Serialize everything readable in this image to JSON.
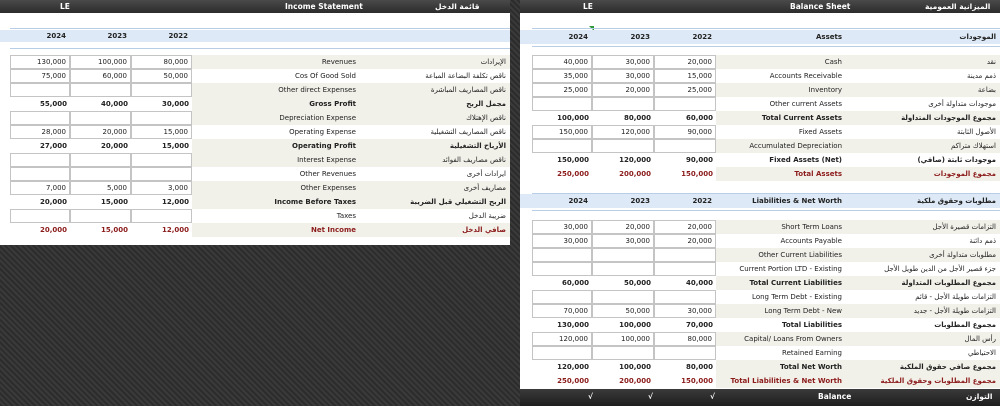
{
  "income": {
    "title_ar": "قائمة الدخل",
    "title_en": "Income Statement",
    "currency": "LE",
    "years": [
      "2022",
      "2023",
      "2024"
    ],
    "rows": [
      {
        "en": "Revenues",
        "ar": "الإيرادات",
        "v": [
          "80,000",
          "100,000",
          "130,000"
        ]
      },
      {
        "en": "Cos Of Good Sold",
        "ar": "ناقص تكلفة البضاعة المباعة",
        "v": [
          "50,000",
          "60,000",
          "75,000"
        ]
      },
      {
        "en": "Other direct Expenses",
        "ar": "ناقص المصاريف المباشرة",
        "v": [
          "",
          "",
          ""
        ]
      },
      {
        "en": "Gross Profit",
        "ar": "مجمل الربح",
        "v": [
          "30,000",
          "40,000",
          "55,000"
        ]
      },
      {
        "en": "Depreciation Expense",
        "ar": "ناقص الإهتلاك",
        "v": [
          "",
          "",
          ""
        ]
      },
      {
        "en": "Operating Expense",
        "ar": "ناقص المصاريف التشغيلية",
        "v": [
          "15,000",
          "20,000",
          "28,000"
        ]
      },
      {
        "en": "Operating Profit",
        "ar": "الأرباح التشغيلية",
        "v": [
          "15,000",
          "20,000",
          "27,000"
        ]
      },
      {
        "en": "Interest Expense",
        "ar": "ناقص مصاريف الفوائد",
        "v": [
          "",
          "",
          ""
        ]
      },
      {
        "en": "Other Revenues",
        "ar": "ايرادات أخرى",
        "v": [
          "",
          "",
          ""
        ]
      },
      {
        "en": "Other Expenses",
        "ar": "مصاريف أخرى",
        "v": [
          "3,000",
          "5,000",
          "7,000"
        ]
      },
      {
        "en": "Income Before Taxes",
        "ar": "الربح التشغيلي قبل الضريبة",
        "v": [
          "12,000",
          "15,000",
          "20,000"
        ]
      },
      {
        "en": "Taxes",
        "ar": "ضريبة الدخل",
        "v": [
          "",
          "",
          ""
        ]
      },
      {
        "en": "Net Income",
        "ar": "صافي الدخل",
        "v": [
          "12,000",
          "15,000",
          "20,000"
        ]
      }
    ]
  },
  "balance": {
    "title_ar": "الميزانية العمومية",
    "title_en": "Balance Sheet",
    "currency": "LE",
    "years": [
      "2022",
      "2023",
      "2024"
    ],
    "assets_en": "Assets",
    "assets_ar": "الموجودات",
    "liab_en": "Liabilities & Net Worth",
    "liab_ar": "مطلوبات وحقوق ملكية",
    "asset_rows": [
      {
        "en": "Cash",
        "ar": "نقد",
        "v": [
          "20,000",
          "30,000",
          "40,000"
        ]
      },
      {
        "en": "Accounts Receivable",
        "ar": "ذمم مدينة",
        "v": [
          "15,000",
          "30,000",
          "35,000"
        ]
      },
      {
        "en": "Inventory",
        "ar": "بضاعة",
        "v": [
          "25,000",
          "20,000",
          "25,000"
        ]
      },
      {
        "en": "Other current Assets",
        "ar": "موجودات متداولة أخرى",
        "v": [
          "",
          "",
          ""
        ]
      },
      {
        "en": "Total Current Assets",
        "ar": "مجموع الموجودات المتداولة",
        "v": [
          "60,000",
          "80,000",
          "100,000"
        ]
      },
      {
        "en": "Fixed Assets",
        "ar": "الأصول الثابتة",
        "v": [
          "90,000",
          "120,000",
          "150,000"
        ]
      },
      {
        "en": "Accumulated Depreciation",
        "ar": "استهلاك متراكم",
        "v": [
          "",
          "",
          ""
        ]
      },
      {
        "en": "Fixed Assets (Net)",
        "ar": "موجودات ثابتة (صافي)",
        "v": [
          "90,000",
          "120,000",
          "150,000"
        ]
      },
      {
        "en": "Total Assets",
        "ar": "مجموع الموجودات",
        "v": [
          "150,000",
          "200,000",
          "250,000"
        ]
      }
    ],
    "liab_rows": [
      {
        "en": "Short Term Loans",
        "ar": "التزامات قصيرة الأجل",
        "v": [
          "20,000",
          "20,000",
          "30,000"
        ]
      },
      {
        "en": "Accounts Payable",
        "ar": "ذمم دائنة",
        "v": [
          "20,000",
          "30,000",
          "30,000"
        ]
      },
      {
        "en": "Other Current Liabilities",
        "ar": "مطلوبات متداولة أخرى",
        "v": [
          "",
          "",
          ""
        ]
      },
      {
        "en": "Current Portion LTD - Existing",
        "ar": "جزء قصير الأجل من الدين طويل الأجل",
        "v": [
          "",
          "",
          ""
        ]
      },
      {
        "en": "Total Current Liabilities",
        "ar": "مجموع المطلوبات المتداولة",
        "v": [
          "40,000",
          "50,000",
          "60,000"
        ]
      },
      {
        "en": "Long Term Debt - Existing",
        "ar": "التزامات طويلة الأجل - قائم",
        "v": [
          "",
          "",
          ""
        ]
      },
      {
        "en": "Long Term Debt - New",
        "ar": "التزامات طويلة الأجل - جديد",
        "v": [
          "30,000",
          "50,000",
          "70,000"
        ]
      },
      {
        "en": "Total Liabilities",
        "ar": "مجموع المطلوبات",
        "v": [
          "70,000",
          "100,000",
          "130,000"
        ]
      },
      {
        "en": "Capital/ Loans From Owners",
        "ar": "رأس المال",
        "v": [
          "80,000",
          "100,000",
          "120,000"
        ]
      },
      {
        "en": "Retained Earning",
        "ar": "الاحتياطي",
        "v": [
          "",
          "",
          ""
        ]
      },
      {
        "en": "Total Net Worth",
        "ar": "مجموع صافي حقوق الملكية",
        "v": [
          "80,000",
          "100,000",
          "120,000"
        ]
      },
      {
        "en": "Total Liabilities & Net Worth",
        "ar": "مجموع المطلوبات وحقوق الملكية",
        "v": [
          "150,000",
          "200,000",
          "250,000"
        ]
      }
    ],
    "balance_en": "Balance",
    "balance_ar": "التوازن",
    "checks": [
      "√",
      "√",
      "√"
    ]
  }
}
